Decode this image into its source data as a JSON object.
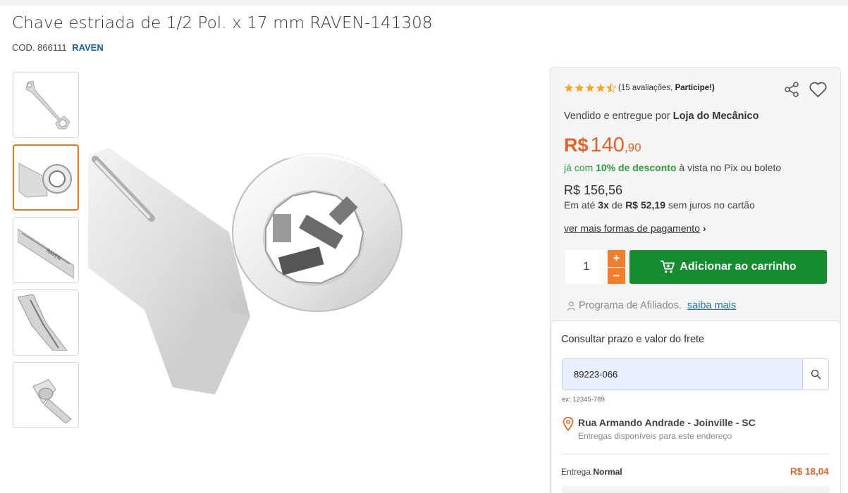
{
  "product": {
    "title": "Chave estriada de 1/2 Pol. x 17 mm RAVEN-141308",
    "code_label": "COD. 866111",
    "brand": "RAVEN"
  },
  "gallery": {
    "thumbnails": [
      {
        "name": "thumb-1",
        "active": false
      },
      {
        "name": "thumb-2",
        "active": true
      },
      {
        "name": "thumb-3",
        "active": false
      },
      {
        "name": "thumb-4",
        "active": false
      },
      {
        "name": "thumb-5",
        "active": false
      }
    ]
  },
  "rating": {
    "stars": 4.5,
    "count_text": "(15 avaliações,",
    "participate": "Participe!)"
  },
  "seller": {
    "prefix": "Vendido e entregue por",
    "name": "Loja do Mecânico"
  },
  "price": {
    "currency": "R$",
    "integer": "140",
    "cents": ",90",
    "pix_prefix": "já com",
    "pix_discount": "10% de desconto",
    "pix_suffix": "à vista no Pix ou boleto",
    "full_price": "R$ 156,56",
    "inst_prefix": "Em até",
    "inst_count": "3x",
    "inst_de": "de",
    "inst_value": "R$ 52,19",
    "inst_suffix": "sem juros no cartão",
    "more_payment": "ver mais formas de pagamento",
    "chevron": "›"
  },
  "cart": {
    "quantity": "1",
    "plus": "+",
    "minus": "−",
    "add_label": "Adicionar ao carrinho"
  },
  "affiliate": {
    "label": "Programa de Afiliados.",
    "link": "saiba mais"
  },
  "shipping": {
    "title": "Consultar prazo e valor do frete",
    "cep_value": "89223-066",
    "example": "ex: 12345-789",
    "street": "Rua Armando Andrade - Joinville - SC",
    "availability": "Entregas disponíveis para este endereço",
    "delivery_prefix": "Entrega",
    "delivery_type": "Normal",
    "delivery_price": "R$ 18,04"
  },
  "colors": {
    "accent_orange": "#e4632a",
    "button_green": "#148c2f",
    "brand_blue": "#1e5ba8",
    "star": "#f5a623"
  },
  "icons": [
    "star-icon",
    "share-icon",
    "heart-icon",
    "cart-icon",
    "person-icon",
    "search-icon",
    "location-pin-icon",
    "chevron-right-icon"
  ]
}
